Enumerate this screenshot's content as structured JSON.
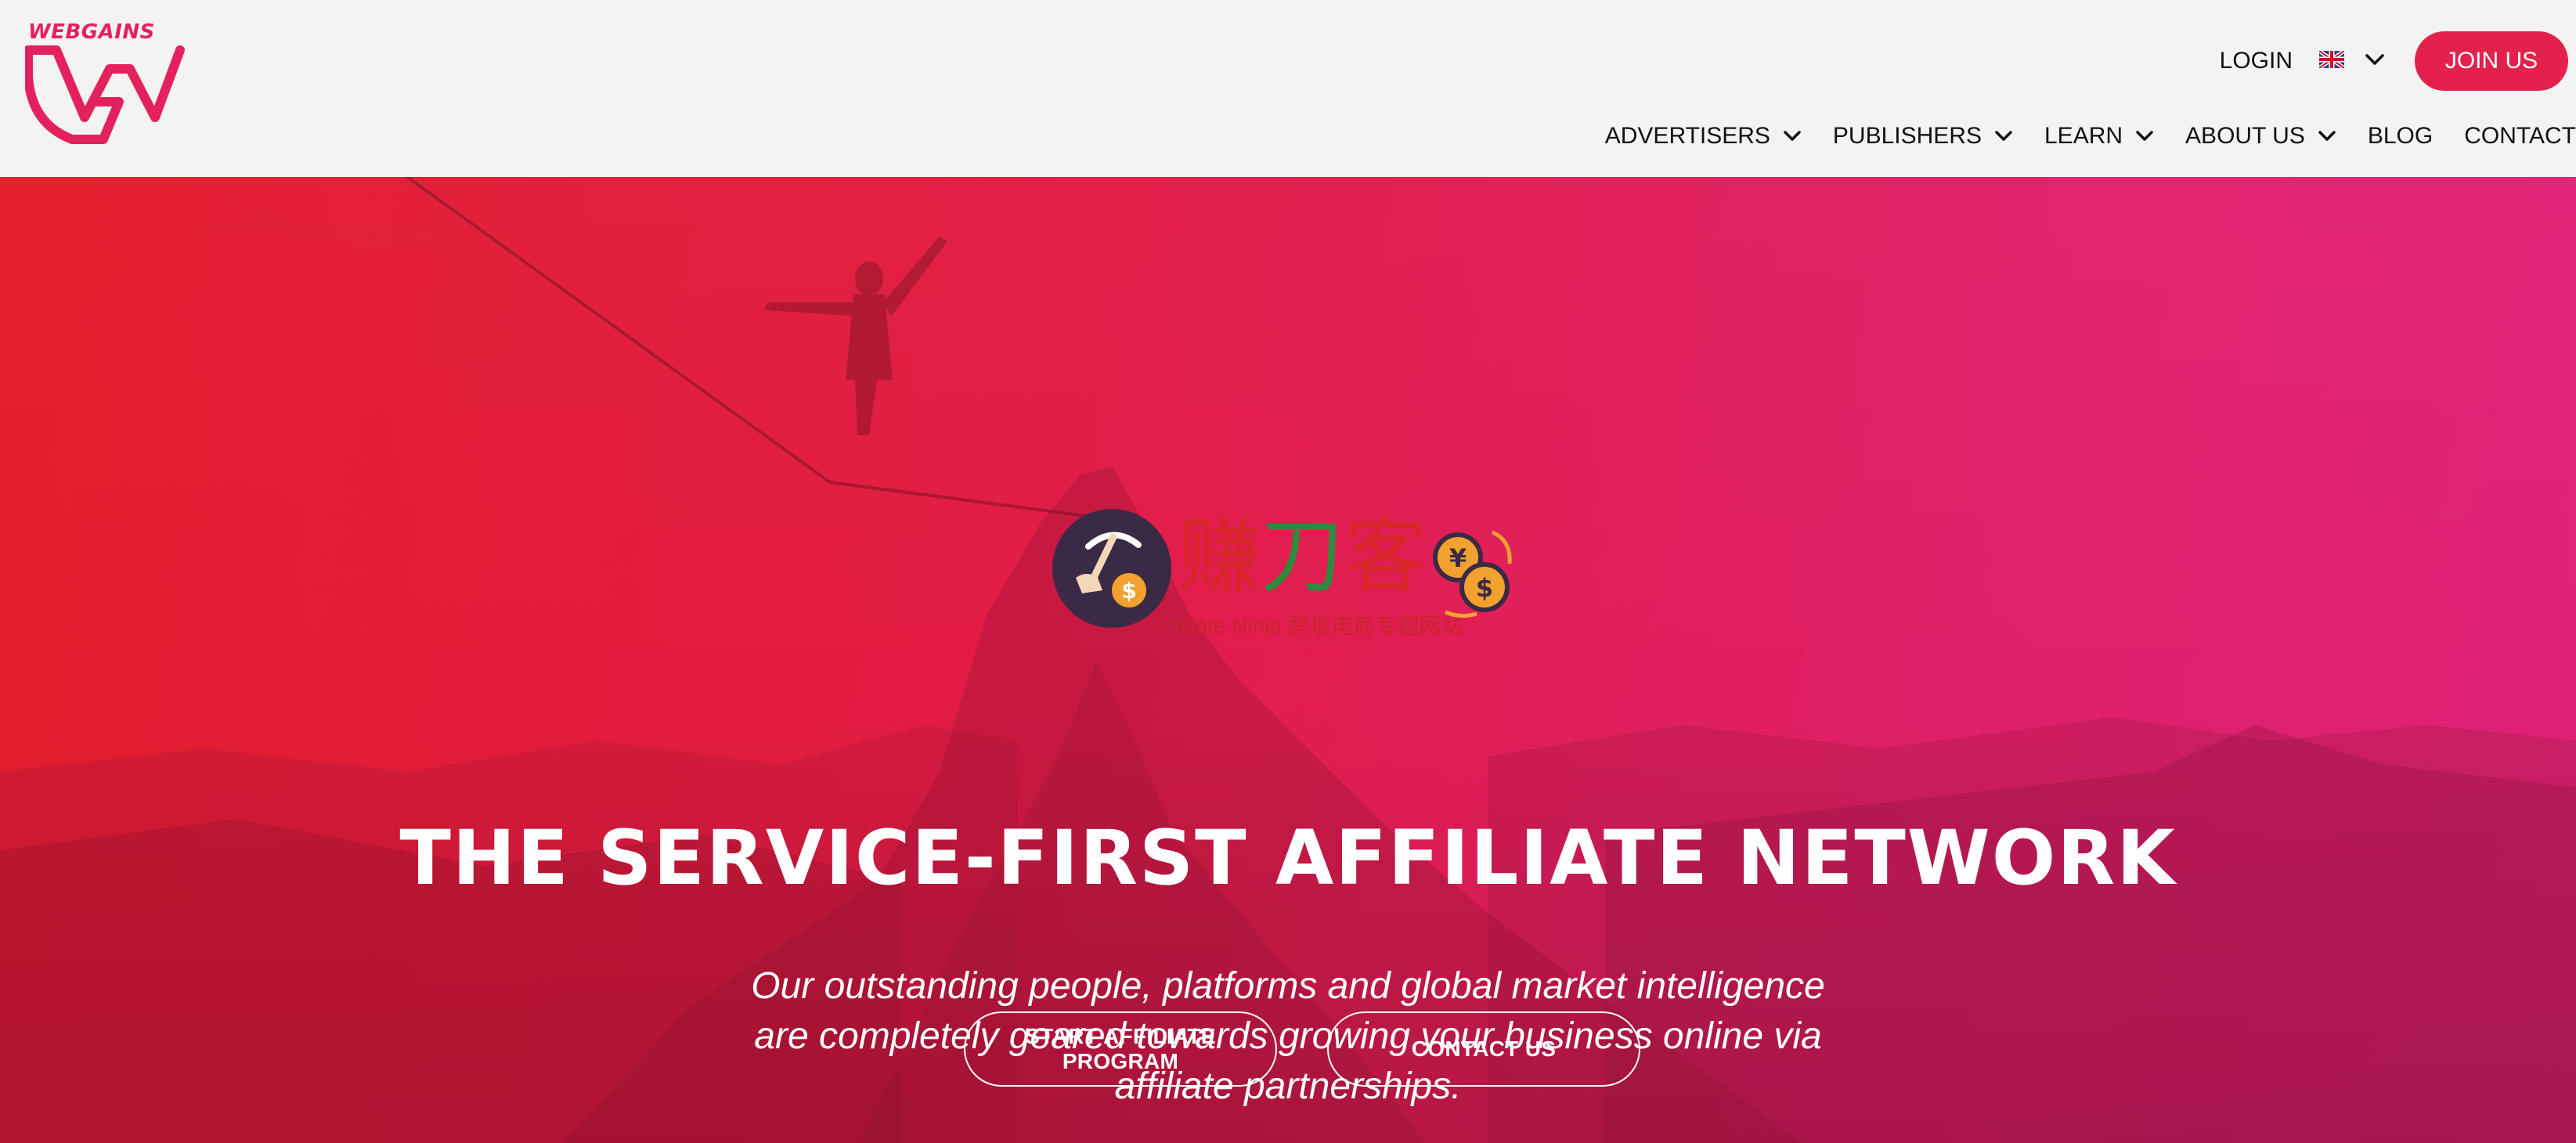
{
  "brand": {
    "logo_text": "WEBGAINS",
    "primary_color": "#e4215f",
    "button_color": "#e4214c"
  },
  "topbar": {
    "login_label": "LOGIN",
    "language_icon": "uk-flag-icon",
    "join_label": "JOIN US"
  },
  "nav": {
    "items": [
      {
        "label": "ADVERTISERS",
        "has_dropdown": true
      },
      {
        "label": "PUBLISHERS",
        "has_dropdown": true
      },
      {
        "label": "LEARN",
        "has_dropdown": true
      },
      {
        "label": "ABOUT US",
        "has_dropdown": true
      },
      {
        "label": "BLOG",
        "has_dropdown": false
      },
      {
        "label": "CONTACT",
        "has_dropdown": false
      }
    ]
  },
  "hero": {
    "title": "THE SERVICE-FIRST AFFILIATE NETWORK",
    "subtitle_lines": [
      "Our outstanding people, platforms and global market intelligence",
      "are completely geared towards growing your business online via",
      "affiliate partnerships."
    ],
    "primary_cta": "START AFFILIATE PROGRAM",
    "secondary_cta": "CONTACT US",
    "gradient_colors": [
      "#e31d2b",
      "#de2279"
    ]
  },
  "watermark": {
    "cn_chars": [
      "赚",
      "刀",
      "客"
    ],
    "sub_text": "Affiliate Ninja 跨境电商专题网站"
  }
}
